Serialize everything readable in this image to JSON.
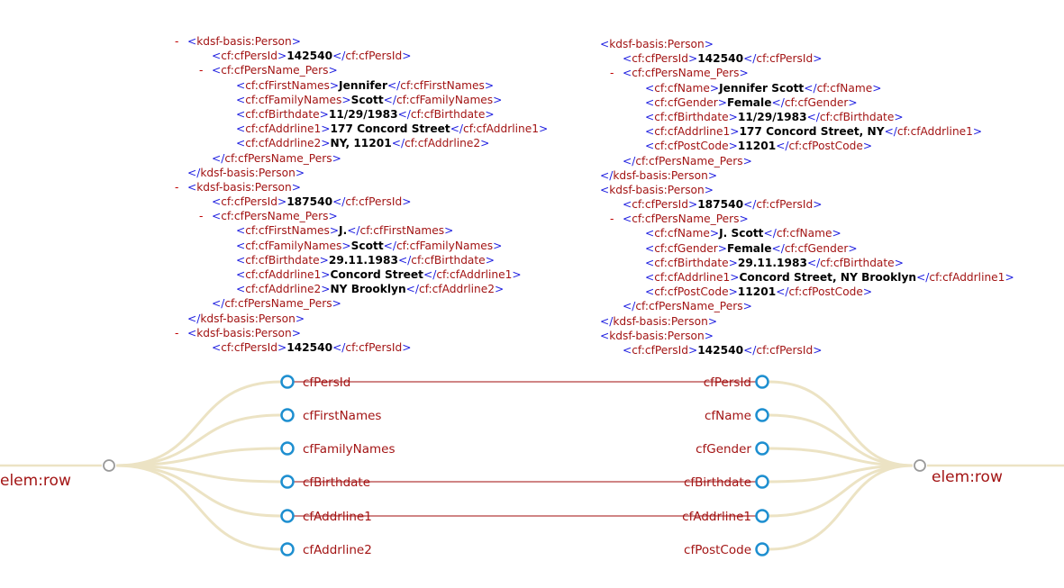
{
  "left_xml": [
    {
      "d": 0,
      "c": true,
      "parts": [
        {
          "k": "b",
          "s": "<"
        },
        {
          "k": "t",
          "s": "kdsf-basis:Person"
        },
        {
          "k": "b",
          "s": ">"
        }
      ]
    },
    {
      "d": 1,
      "parts": [
        {
          "k": "b",
          "s": "<"
        },
        {
          "k": "t",
          "s": "cf:cfPersId"
        },
        {
          "k": "b",
          "s": ">"
        },
        {
          "k": "v",
          "s": "142540"
        },
        {
          "k": "b",
          "s": "</"
        },
        {
          "k": "t",
          "s": "cf:cfPersId"
        },
        {
          "k": "b",
          "s": ">"
        }
      ]
    },
    {
      "d": 1,
      "c": true,
      "parts": [
        {
          "k": "b",
          "s": "<"
        },
        {
          "k": "t",
          "s": "cf:cfPersName_Pers"
        },
        {
          "k": "b",
          "s": ">"
        }
      ]
    },
    {
      "d": 2,
      "parts": [
        {
          "k": "b",
          "s": "<"
        },
        {
          "k": "t",
          "s": "cf:cfFirstNames"
        },
        {
          "k": "b",
          "s": ">"
        },
        {
          "k": "v",
          "s": "Jennifer"
        },
        {
          "k": "b",
          "s": "</"
        },
        {
          "k": "t",
          "s": "cf:cfFirstNames"
        },
        {
          "k": "b",
          "s": ">"
        }
      ]
    },
    {
      "d": 2,
      "parts": [
        {
          "k": "b",
          "s": "<"
        },
        {
          "k": "t",
          "s": "cf:cfFamilyNames"
        },
        {
          "k": "b",
          "s": ">"
        },
        {
          "k": "v",
          "s": "Scott"
        },
        {
          "k": "b",
          "s": "</"
        },
        {
          "k": "t",
          "s": "cf:cfFamilyNames"
        },
        {
          "k": "b",
          "s": ">"
        }
      ]
    },
    {
      "d": 2,
      "parts": [
        {
          "k": "b",
          "s": "<"
        },
        {
          "k": "t",
          "s": "cf:cfBirthdate"
        },
        {
          "k": "b",
          "s": ">"
        },
        {
          "k": "v",
          "s": "11/29/1983"
        },
        {
          "k": "b",
          "s": "</"
        },
        {
          "k": "t",
          "s": "cf:cfBirthdate"
        },
        {
          "k": "b",
          "s": ">"
        }
      ]
    },
    {
      "d": 2,
      "parts": [
        {
          "k": "b",
          "s": "<"
        },
        {
          "k": "t",
          "s": "cf:cfAddrline1"
        },
        {
          "k": "b",
          "s": ">"
        },
        {
          "k": "v",
          "s": "177 Concord Street"
        },
        {
          "k": "b",
          "s": "</"
        },
        {
          "k": "t",
          "s": "cf:cfAddrline1"
        },
        {
          "k": "b",
          "s": ">"
        }
      ]
    },
    {
      "d": 2,
      "parts": [
        {
          "k": "b",
          "s": "<"
        },
        {
          "k": "t",
          "s": "cf:cfAddrline2"
        },
        {
          "k": "b",
          "s": ">"
        },
        {
          "k": "v",
          "s": "NY, 11201"
        },
        {
          "k": "b",
          "s": "</"
        },
        {
          "k": "t",
          "s": "cf:cfAddrline2"
        },
        {
          "k": "b",
          "s": ">"
        }
      ]
    },
    {
      "d": 1,
      "parts": [
        {
          "k": "b",
          "s": "</"
        },
        {
          "k": "t",
          "s": "cf:cfPersName_Pers"
        },
        {
          "k": "b",
          "s": ">"
        }
      ]
    },
    {
      "d": 0,
      "parts": [
        {
          "k": "b",
          "s": "</"
        },
        {
          "k": "t",
          "s": "kdsf-basis:Person"
        },
        {
          "k": "b",
          "s": ">"
        }
      ]
    },
    {
      "d": 0,
      "c": true,
      "parts": [
        {
          "k": "b",
          "s": "<"
        },
        {
          "k": "t",
          "s": "kdsf-basis:Person"
        },
        {
          "k": "b",
          "s": ">"
        }
      ]
    },
    {
      "d": 1,
      "parts": [
        {
          "k": "b",
          "s": "<"
        },
        {
          "k": "t",
          "s": "cf:cfPersId"
        },
        {
          "k": "b",
          "s": ">"
        },
        {
          "k": "v",
          "s": "187540"
        },
        {
          "k": "b",
          "s": "</"
        },
        {
          "k": "t",
          "s": "cf:cfPersId"
        },
        {
          "k": "b",
          "s": ">"
        }
      ]
    },
    {
      "d": 1,
      "c": true,
      "parts": [
        {
          "k": "b",
          "s": "<"
        },
        {
          "k": "t",
          "s": "cf:cfPersName_Pers"
        },
        {
          "k": "b",
          "s": ">"
        }
      ]
    },
    {
      "d": 2,
      "parts": [
        {
          "k": "b",
          "s": "<"
        },
        {
          "k": "t",
          "s": "cf:cfFirstNames"
        },
        {
          "k": "b",
          "s": ">"
        },
        {
          "k": "v",
          "s": "J."
        },
        {
          "k": "b",
          "s": "</"
        },
        {
          "k": "t",
          "s": "cf:cfFirstNames"
        },
        {
          "k": "b",
          "s": ">"
        }
      ]
    },
    {
      "d": 2,
      "parts": [
        {
          "k": "b",
          "s": "<"
        },
        {
          "k": "t",
          "s": "cf:cfFamilyNames"
        },
        {
          "k": "b",
          "s": ">"
        },
        {
          "k": "v",
          "s": "Scott"
        },
        {
          "k": "b",
          "s": "</"
        },
        {
          "k": "t",
          "s": "cf:cfFamilyNames"
        },
        {
          "k": "b",
          "s": ">"
        }
      ]
    },
    {
      "d": 2,
      "parts": [
        {
          "k": "b",
          "s": "<"
        },
        {
          "k": "t",
          "s": "cf:cfBirthdate"
        },
        {
          "k": "b",
          "s": ">"
        },
        {
          "k": "v",
          "s": "29.11.1983"
        },
        {
          "k": "b",
          "s": "</"
        },
        {
          "k": "t",
          "s": "cf:cfBirthdate"
        },
        {
          "k": "b",
          "s": ">"
        }
      ]
    },
    {
      "d": 2,
      "parts": [
        {
          "k": "b",
          "s": "<"
        },
        {
          "k": "t",
          "s": "cf:cfAddrline1"
        },
        {
          "k": "b",
          "s": ">"
        },
        {
          "k": "v",
          "s": "Concord Street"
        },
        {
          "k": "b",
          "s": "</"
        },
        {
          "k": "t",
          "s": "cf:cfAddrline1"
        },
        {
          "k": "b",
          "s": ">"
        }
      ]
    },
    {
      "d": 2,
      "parts": [
        {
          "k": "b",
          "s": "<"
        },
        {
          "k": "t",
          "s": "cf:cfAddrline2"
        },
        {
          "k": "b",
          "s": ">"
        },
        {
          "k": "v",
          "s": "NY Brooklyn"
        },
        {
          "k": "b",
          "s": "</"
        },
        {
          "k": "t",
          "s": "cf:cfAddrline2"
        },
        {
          "k": "b",
          "s": ">"
        }
      ]
    },
    {
      "d": 1,
      "parts": [
        {
          "k": "b",
          "s": "</"
        },
        {
          "k": "t",
          "s": "cf:cfPersName_Pers"
        },
        {
          "k": "b",
          "s": ">"
        }
      ]
    },
    {
      "d": 0,
      "parts": [
        {
          "k": "b",
          "s": "</"
        },
        {
          "k": "t",
          "s": "kdsf-basis:Person"
        },
        {
          "k": "b",
          "s": ">"
        }
      ]
    },
    {
      "d": 0,
      "c": true,
      "parts": [
        {
          "k": "b",
          "s": "<"
        },
        {
          "k": "t",
          "s": "kdsf-basis:Person"
        },
        {
          "k": "b",
          "s": ">"
        }
      ]
    },
    {
      "d": 1,
      "parts": [
        {
          "k": "b",
          "s": "<"
        },
        {
          "k": "t",
          "s": "cf:cfPersId"
        },
        {
          "k": "b",
          "s": ">"
        },
        {
          "k": "v",
          "s": "142540"
        },
        {
          "k": "b",
          "s": "</"
        },
        {
          "k": "t",
          "s": "cf:cfPersId"
        },
        {
          "k": "b",
          "s": ">"
        }
      ]
    }
  ],
  "right_xml": [
    {
      "d": 0,
      "parts": [
        {
          "k": "b",
          "s": "<"
        },
        {
          "k": "t",
          "s": "kdsf-basis:Person"
        },
        {
          "k": "b",
          "s": ">"
        }
      ]
    },
    {
      "d": 1,
      "parts": [
        {
          "k": "b",
          "s": "<"
        },
        {
          "k": "t",
          "s": "cf:cfPersId"
        },
        {
          "k": "b",
          "s": ">"
        },
        {
          "k": "v",
          "s": "142540"
        },
        {
          "k": "b",
          "s": "</"
        },
        {
          "k": "t",
          "s": "cf:cfPersId"
        },
        {
          "k": "b",
          "s": ">"
        }
      ]
    },
    {
      "d": 1,
      "c": true,
      "parts": [
        {
          "k": "b",
          "s": "<"
        },
        {
          "k": "t",
          "s": "cf:cfPersName_Pers"
        },
        {
          "k": "b",
          "s": ">"
        }
      ]
    },
    {
      "d": 2,
      "parts": [
        {
          "k": "b",
          "s": "<"
        },
        {
          "k": "t",
          "s": "cf:cfName"
        },
        {
          "k": "b",
          "s": ">"
        },
        {
          "k": "v",
          "s": "Jennifer Scott"
        },
        {
          "k": "b",
          "s": "</"
        },
        {
          "k": "t",
          "s": "cf:cfName"
        },
        {
          "k": "b",
          "s": ">"
        }
      ]
    },
    {
      "d": 2,
      "parts": [
        {
          "k": "b",
          "s": "<"
        },
        {
          "k": "t",
          "s": "cf:cfGender"
        },
        {
          "k": "b",
          "s": ">"
        },
        {
          "k": "v",
          "s": "Female"
        },
        {
          "k": "b",
          "s": "</"
        },
        {
          "k": "t",
          "s": "cf:cfGender"
        },
        {
          "k": "b",
          "s": ">"
        }
      ]
    },
    {
      "d": 2,
      "parts": [
        {
          "k": "b",
          "s": "<"
        },
        {
          "k": "t",
          "s": "cf:cfBirthdate"
        },
        {
          "k": "b",
          "s": ">"
        },
        {
          "k": "v",
          "s": "11/29/1983"
        },
        {
          "k": "b",
          "s": "</"
        },
        {
          "k": "t",
          "s": "cf:cfBirthdate"
        },
        {
          "k": "b",
          "s": ">"
        }
      ]
    },
    {
      "d": 2,
      "parts": [
        {
          "k": "b",
          "s": "<"
        },
        {
          "k": "t",
          "s": "cf:cfAddrline1"
        },
        {
          "k": "b",
          "s": ">"
        },
        {
          "k": "v",
          "s": "177 Concord Street, NY"
        },
        {
          "k": "b",
          "s": "</"
        },
        {
          "k": "t",
          "s": "cf:cfAddrline1"
        },
        {
          "k": "b",
          "s": ">"
        }
      ]
    },
    {
      "d": 2,
      "parts": [
        {
          "k": "b",
          "s": "<"
        },
        {
          "k": "t",
          "s": "cf:cfPostCode"
        },
        {
          "k": "b",
          "s": ">"
        },
        {
          "k": "v",
          "s": "11201"
        },
        {
          "k": "b",
          "s": "</"
        },
        {
          "k": "t",
          "s": "cf:cfPostCode"
        },
        {
          "k": "b",
          "s": ">"
        }
      ]
    },
    {
      "d": 1,
      "parts": [
        {
          "k": "b",
          "s": "</"
        },
        {
          "k": "t",
          "s": "cf:cfPersName_Pers"
        },
        {
          "k": "b",
          "s": ">"
        }
      ]
    },
    {
      "d": 0,
      "parts": [
        {
          "k": "b",
          "s": "</"
        },
        {
          "k": "t",
          "s": "kdsf-basis:Person"
        },
        {
          "k": "b",
          "s": ">"
        }
      ]
    },
    {
      "d": 0,
      "parts": [
        {
          "k": "b",
          "s": "<"
        },
        {
          "k": "t",
          "s": "kdsf-basis:Person"
        },
        {
          "k": "b",
          "s": ">"
        }
      ]
    },
    {
      "d": 1,
      "parts": [
        {
          "k": "b",
          "s": "<"
        },
        {
          "k": "t",
          "s": "cf:cfPersId"
        },
        {
          "k": "b",
          "s": ">"
        },
        {
          "k": "v",
          "s": "187540"
        },
        {
          "k": "b",
          "s": "</"
        },
        {
          "k": "t",
          "s": "cf:cfPersId"
        },
        {
          "k": "b",
          "s": ">"
        }
      ]
    },
    {
      "d": 1,
      "c": true,
      "parts": [
        {
          "k": "b",
          "s": "<"
        },
        {
          "k": "t",
          "s": "cf:cfPersName_Pers"
        },
        {
          "k": "b",
          "s": ">"
        }
      ]
    },
    {
      "d": 2,
      "parts": [
        {
          "k": "b",
          "s": "<"
        },
        {
          "k": "t",
          "s": "cf:cfName"
        },
        {
          "k": "b",
          "s": ">"
        },
        {
          "k": "v",
          "s": "J. Scott"
        },
        {
          "k": "b",
          "s": "</"
        },
        {
          "k": "t",
          "s": "cf:cfName"
        },
        {
          "k": "b",
          "s": ">"
        }
      ]
    },
    {
      "d": 2,
      "parts": [
        {
          "k": "b",
          "s": "<"
        },
        {
          "k": "t",
          "s": "cf:cfGender"
        },
        {
          "k": "b",
          "s": ">"
        },
        {
          "k": "v",
          "s": "Female"
        },
        {
          "k": "b",
          "s": "</"
        },
        {
          "k": "t",
          "s": "cf:cfGender"
        },
        {
          "k": "b",
          "s": ">"
        }
      ]
    },
    {
      "d": 2,
      "parts": [
        {
          "k": "b",
          "s": "<"
        },
        {
          "k": "t",
          "s": "cf:cfBirthdate"
        },
        {
          "k": "b",
          "s": ">"
        },
        {
          "k": "v",
          "s": "29.11.1983"
        },
        {
          "k": "b",
          "s": "</"
        },
        {
          "k": "t",
          "s": "cf:cfBirthdate"
        },
        {
          "k": "b",
          "s": ">"
        }
      ]
    },
    {
      "d": 2,
      "parts": [
        {
          "k": "b",
          "s": "<"
        },
        {
          "k": "t",
          "s": "cf:cfAddrline1"
        },
        {
          "k": "b",
          "s": ">"
        },
        {
          "k": "v",
          "s": "Concord Street, NY Brooklyn"
        },
        {
          "k": "b",
          "s": "</"
        },
        {
          "k": "t",
          "s": "cf:cfAddrline1"
        },
        {
          "k": "b",
          "s": ">"
        }
      ]
    },
    {
      "d": 2,
      "parts": [
        {
          "k": "b",
          "s": "<"
        },
        {
          "k": "t",
          "s": "cf:cfPostCode"
        },
        {
          "k": "b",
          "s": ">"
        },
        {
          "k": "v",
          "s": "11201"
        },
        {
          "k": "b",
          "s": "</"
        },
        {
          "k": "t",
          "s": "cf:cfPostCode"
        },
        {
          "k": "b",
          "s": ">"
        }
      ]
    },
    {
      "d": 1,
      "parts": [
        {
          "k": "b",
          "s": "</"
        },
        {
          "k": "t",
          "s": "cf:cfPersName_Pers"
        },
        {
          "k": "b",
          "s": ">"
        }
      ]
    },
    {
      "d": 0,
      "parts": [
        {
          "k": "b",
          "s": "</"
        },
        {
          "k": "t",
          "s": "kdsf-basis:Person"
        },
        {
          "k": "b",
          "s": ">"
        }
      ]
    },
    {
      "d": 0,
      "parts": [
        {
          "k": "b",
          "s": "<"
        },
        {
          "k": "t",
          "s": "kdsf-basis:Person"
        },
        {
          "k": "b",
          "s": ">"
        }
      ]
    },
    {
      "d": 1,
      "parts": [
        {
          "k": "b",
          "s": "<"
        },
        {
          "k": "t",
          "s": "cf:cfPersId"
        },
        {
          "k": "b",
          "s": ">"
        },
        {
          "k": "v",
          "s": "142540"
        },
        {
          "k": "b",
          "s": "</"
        },
        {
          "k": "t",
          "s": "cf:cfPersId"
        },
        {
          "k": "b",
          "s": ">"
        }
      ]
    }
  ],
  "collapse_symbol": "-",
  "mapping": {
    "left_root": "elem:row",
    "right_root": "elem:row",
    "left_fields": [
      "cfPersId",
      "cfFirstNames",
      "cfFamilyNames",
      "cfBirthdate",
      "cfAddrline1",
      "cfAddrline2"
    ],
    "right_fields": [
      "cfPersId",
      "cfName",
      "cfGender",
      "cfBirthdate",
      "cfAddrline1",
      "cfPostCode"
    ],
    "links": [
      [
        0,
        0
      ],
      [
        3,
        3
      ],
      [
        4,
        4
      ]
    ]
  },
  "colors": {
    "bracket": "#2020e0",
    "tag": "#a31515",
    "value": "#000000",
    "collapse": "#c00000",
    "branch": "#ece3c4",
    "node_ring": "#1e8fd0",
    "root_ring": "#9a9a9a",
    "link_line": "#b53c3c",
    "field_text": "#a31515"
  }
}
